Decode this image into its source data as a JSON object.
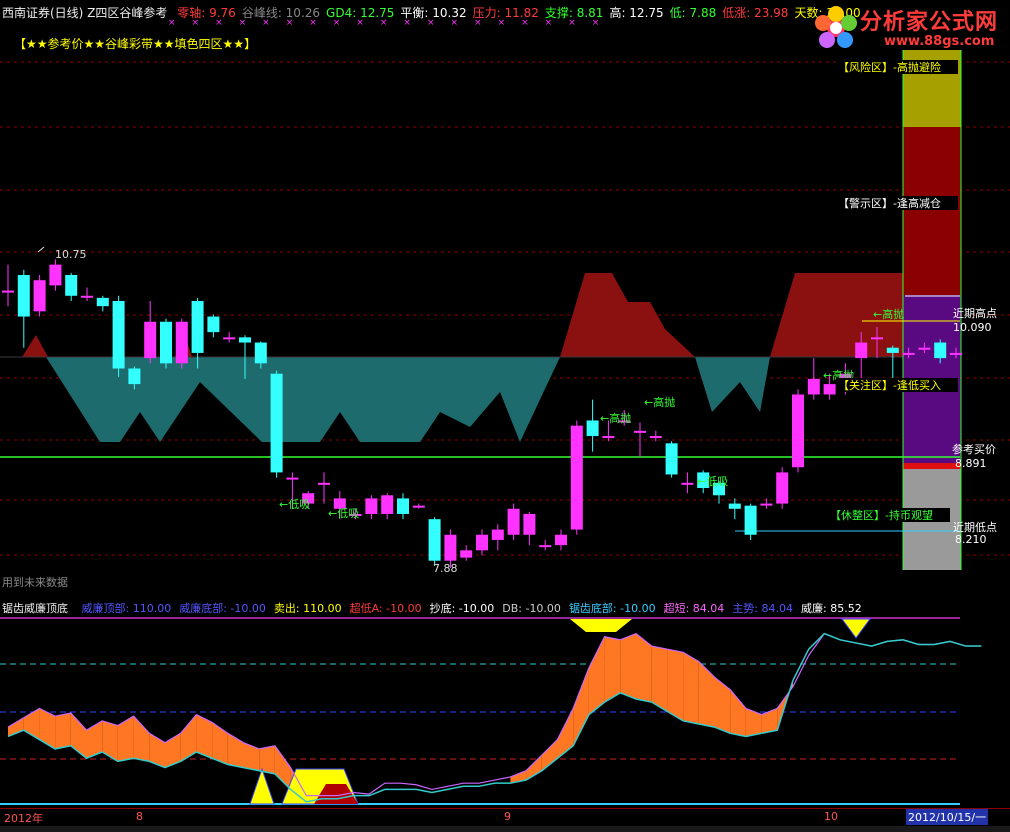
{
  "header": {
    "title": "西南证券(日线) Z四区谷峰参考",
    "items": [
      {
        "label": "零轴:",
        "value": "9.76",
        "color": "#ff3b3b"
      },
      {
        "label": "谷峰线:",
        "value": "10.26",
        "color": "#888888"
      },
      {
        "label": "GD4:",
        "value": "12.75",
        "color": "#33ff33"
      },
      {
        "label": "平衡:",
        "value": "10.32",
        "color": "#ffffff"
      },
      {
        "label": "压力:",
        "value": "11.82",
        "color": "#ff3b3b"
      },
      {
        "label": "支撑:",
        "value": "8.81",
        "color": "#33ff33"
      },
      {
        "label": "高:",
        "value": "12.75",
        "color": "#ffffff"
      },
      {
        "label": "低:",
        "value": "7.88",
        "color": "#33ff33"
      },
      {
        "label": "低涨:",
        "value": "23.98",
        "color": "#ff3b3b"
      },
      {
        "label": "天数:",
        "value": "33.00",
        "color": "#ffff00"
      }
    ]
  },
  "logo": {
    "name": "分析家公式网",
    "url": "www.88gs.com"
  },
  "legend_line": "【★★参考价★★谷峰彩带★★填色四区★★】",
  "footnote": "用到未来数据",
  "main_labels": {
    "high_price": "10.75",
    "low_price": "7.88",
    "sell_signals": [
      "←高抛",
      "←高抛",
      "←高抛",
      "←高抛"
    ],
    "buy_signals": [
      "←低吸",
      "←低吸",
      "←低吸"
    ],
    "zones": [
      "【风险区】-高抛避险",
      "【警示区】-逢高减仓",
      "【关注区】-逢低买入",
      "【休整区】-持币观望"
    ],
    "near_high_label": "近期高点",
    "near_high_value": "10.090",
    "ref_buy_label": "参考买价",
    "ref_buy_value": "8.891",
    "near_low_label": "近期低点",
    "near_low_value": "8.210"
  },
  "indicator": {
    "title": "锯齿威廉顶底",
    "items": [
      {
        "label": "威廉顶部:",
        "value": "110.00",
        "color": "#5555ff"
      },
      {
        "label": "威廉底部:",
        "value": "-10.00",
        "color": "#5555ff"
      },
      {
        "label": "卖出:",
        "value": "110.00",
        "color": "#ffff00"
      },
      {
        "label": "超低A:",
        "value": "-10.00",
        "color": "#ff3b3b"
      },
      {
        "label": "抄底:",
        "value": "-10.00",
        "color": "#ffffff"
      },
      {
        "label": "DB:",
        "value": "-10.00",
        "color": "#cccccc"
      },
      {
        "label": "锯齿底部:",
        "value": "-10.00",
        "color": "#33ccff"
      },
      {
        "label": "超短:",
        "value": "84.04",
        "color": "#ff66ff"
      },
      {
        "label": "主势:",
        "value": "84.04",
        "color": "#5555ff"
      },
      {
        "label": "威廉:",
        "value": "85.52",
        "color": "#ffffff"
      }
    ]
  },
  "axis": {
    "year_label": "2012年",
    "month_labels": [
      "8",
      "9",
      "10"
    ],
    "current_date": "2012/10/15/一"
  },
  "chart_data": [
    {
      "type": "candlestick",
      "title": "西南证券(日线)",
      "ylim": [
        7.6,
        12.9
      ],
      "zone_colors": {
        "risk": "#a6a000",
        "warning": "#8b0000",
        "attention": "#5a0a80",
        "rest": "#9a9a9a"
      },
      "candles": [
        {
          "o": 10.55,
          "c": 10.55,
          "h": 10.8,
          "l": 10.4
        },
        {
          "o": 10.7,
          "c": 10.3,
          "h": 10.75,
          "l": 10.0
        },
        {
          "o": 10.35,
          "c": 10.65,
          "h": 10.7,
          "l": 10.3
        },
        {
          "o": 10.6,
          "c": 10.8,
          "h": 10.85,
          "l": 10.55
        },
        {
          "o": 10.7,
          "c": 10.5,
          "h": 10.72,
          "l": 10.45
        },
        {
          "o": 10.5,
          "c": 10.5,
          "h": 10.58,
          "l": 10.45
        },
        {
          "o": 10.48,
          "c": 10.4,
          "h": 10.5,
          "l": 10.35
        },
        {
          "o": 10.45,
          "c": 9.8,
          "h": 10.5,
          "l": 9.72
        },
        {
          "o": 9.8,
          "c": 9.65,
          "h": 9.82,
          "l": 9.6
        },
        {
          "o": 9.9,
          "c": 10.25,
          "h": 10.45,
          "l": 9.85
        },
        {
          "o": 10.25,
          "c": 9.85,
          "h": 10.28,
          "l": 9.8
        },
        {
          "o": 9.85,
          "c": 10.25,
          "h": 10.28,
          "l": 9.8
        },
        {
          "o": 10.45,
          "c": 9.95,
          "h": 10.48,
          "l": 9.8
        },
        {
          "o": 10.3,
          "c": 10.15,
          "h": 10.32,
          "l": 10.1
        },
        {
          "o": 10.1,
          "c": 10.1,
          "h": 10.15,
          "l": 10.05
        },
        {
          "o": 10.1,
          "c": 10.05,
          "h": 10.12,
          "l": 9.7
        },
        {
          "o": 10.05,
          "c": 9.85,
          "h": 10.06,
          "l": 9.8
        },
        {
          "o": 9.75,
          "c": 8.8,
          "h": 9.78,
          "l": 8.75
        },
        {
          "o": 8.75,
          "c": 8.75,
          "h": 8.8,
          "l": 8.45
        },
        {
          "o": 8.5,
          "c": 8.6,
          "h": 8.62,
          "l": 8.45
        },
        {
          "o": 8.7,
          "c": 8.7,
          "h": 8.8,
          "l": 8.5
        },
        {
          "o": 8.45,
          "c": 8.55,
          "h": 8.62,
          "l": 8.35
        },
        {
          "o": 8.4,
          "c": 8.4,
          "h": 8.45,
          "l": 8.35
        },
        {
          "o": 8.4,
          "c": 8.55,
          "h": 8.58,
          "l": 8.35
        },
        {
          "o": 8.4,
          "c": 8.58,
          "h": 8.6,
          "l": 8.35
        },
        {
          "o": 8.55,
          "c": 8.4,
          "h": 8.6,
          "l": 8.35
        },
        {
          "o": 8.48,
          "c": 8.48,
          "h": 8.5,
          "l": 8.45
        },
        {
          "o": 8.35,
          "c": 7.95,
          "h": 8.37,
          "l": 7.9
        },
        {
          "o": 7.95,
          "c": 8.2,
          "h": 8.25,
          "l": 7.88
        },
        {
          "o": 7.98,
          "c": 8.05,
          "h": 8.1,
          "l": 7.95
        },
        {
          "o": 8.05,
          "c": 8.2,
          "h": 8.25,
          "l": 8.0
        },
        {
          "o": 8.15,
          "c": 8.25,
          "h": 8.3,
          "l": 8.05
        },
        {
          "o": 8.2,
          "c": 8.45,
          "h": 8.5,
          "l": 8.15
        },
        {
          "o": 8.2,
          "c": 8.4,
          "h": 8.42,
          "l": 8.1
        },
        {
          "o": 8.1,
          "c": 8.1,
          "h": 8.15,
          "l": 8.05
        },
        {
          "o": 8.1,
          "c": 8.2,
          "h": 8.25,
          "l": 8.05
        },
        {
          "o": 8.25,
          "c": 9.25,
          "h": 9.3,
          "l": 8.2
        },
        {
          "o": 9.3,
          "c": 9.15,
          "h": 9.5,
          "l": 9.0
        },
        {
          "o": 9.15,
          "c": 9.15,
          "h": 9.3,
          "l": 9.1
        },
        {
          "o": 9.3,
          "c": 9.3,
          "h": 9.4,
          "l": 9.25
        },
        {
          "o": 9.2,
          "c": 9.2,
          "h": 9.28,
          "l": 8.95
        },
        {
          "o": 9.15,
          "c": 9.15,
          "h": 9.2,
          "l": 9.1
        },
        {
          "o": 9.08,
          "c": 8.78,
          "h": 9.1,
          "l": 8.75
        },
        {
          "o": 8.7,
          "c": 8.7,
          "h": 8.8,
          "l": 8.6
        },
        {
          "o": 8.8,
          "c": 8.65,
          "h": 8.82,
          "l": 8.6
        },
        {
          "o": 8.7,
          "c": 8.58,
          "h": 8.72,
          "l": 8.5
        },
        {
          "o": 8.5,
          "c": 8.45,
          "h": 8.55,
          "l": 8.35
        },
        {
          "o": 8.48,
          "c": 8.2,
          "h": 8.5,
          "l": 8.15
        },
        {
          "o": 8.5,
          "c": 8.5,
          "h": 8.55,
          "l": 8.45
        },
        {
          "o": 8.5,
          "c": 8.8,
          "h": 8.85,
          "l": 8.45
        },
        {
          "o": 8.85,
          "c": 9.55,
          "h": 9.6,
          "l": 8.8
        },
        {
          "o": 9.55,
          "c": 9.7,
          "h": 9.9,
          "l": 9.5
        },
        {
          "o": 9.55,
          "c": 9.65,
          "h": 9.75,
          "l": 9.5
        },
        {
          "o": 9.6,
          "c": 9.75,
          "h": 9.85,
          "l": 9.55
        },
        {
          "o": 9.9,
          "c": 10.05,
          "h": 10.15,
          "l": 9.7
        },
        {
          "o": 10.1,
          "c": 10.1,
          "h": 10.2,
          "l": 9.9
        },
        {
          "o": 10.0,
          "c": 9.95,
          "h": 10.02,
          "l": 9.7
        },
        {
          "o": 9.95,
          "c": 9.95,
          "h": 10.0,
          "l": 9.9
        },
        {
          "o": 10.0,
          "c": 10.0,
          "h": 10.05,
          "l": 9.95
        },
        {
          "o": 10.05,
          "c": 9.9,
          "h": 10.08,
          "l": 9.85
        },
        {
          "o": 9.95,
          "c": 9.95,
          "h": 10.0,
          "l": 9.9
        }
      ],
      "reference_lines": {
        "ref_buy": 8.891,
        "near_high": 10.09,
        "near_low": 8.21
      }
    },
    {
      "type": "line",
      "title": "锯齿威廉顶底",
      "ylim": [
        -12,
        112
      ],
      "series": [
        {
          "name": "威廉",
          "values": [
            40,
            46,
            52,
            47,
            49,
            38,
            44,
            41,
            47,
            36,
            30,
            36,
            48,
            43,
            36,
            30,
            26,
            28,
            14,
            -4,
            -4,
            -4,
            -2,
            -3,
            4,
            4,
            3,
            0,
            2,
            4,
            4,
            6,
            8,
            12,
            22,
            32,
            52,
            78,
            98,
            96,
            100,
            92,
            90,
            88,
            82,
            72,
            64,
            52,
            48,
            52,
            66,
            86,
            100,
            96,
            94,
            92,
            95,
            96,
            93,
            93,
            95,
            92,
            92
          ]
        },
        {
          "name": "锯齿底部",
          "values": [
            34,
            38,
            32,
            26,
            28,
            20,
            24,
            18,
            20,
            18,
            14,
            18,
            24,
            20,
            16,
            14,
            12,
            10,
            0,
            -8,
            -6,
            -6,
            -4,
            -4,
            0,
            0,
            0,
            -2,
            0,
            2,
            2,
            4,
            4,
            6,
            12,
            20,
            28,
            48,
            56,
            62,
            58,
            56,
            50,
            44,
            42,
            40,
            36,
            34,
            36,
            38,
            70,
            90,
            100,
            96,
            94,
            92,
            95,
            96,
            93,
            93,
            95,
            92,
            92
          ]
        }
      ]
    }
  ]
}
